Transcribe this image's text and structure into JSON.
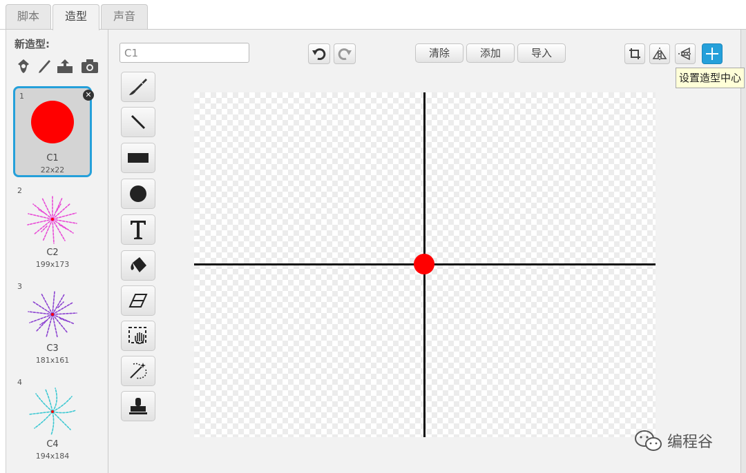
{
  "tabs": [
    {
      "label": "脚本",
      "active": false
    },
    {
      "label": "造型",
      "active": true
    },
    {
      "label": "声音",
      "active": false
    }
  ],
  "left_panel": {
    "new_costume_label": "新造型:",
    "new_costume_icons": [
      "character-icon",
      "paintbrush-icon",
      "upload-icon",
      "camera-icon"
    ]
  },
  "costumes": [
    {
      "number": "1",
      "name": "C1",
      "size": "22x22",
      "selected": true,
      "color": "#ff0000"
    },
    {
      "number": "2",
      "name": "C2",
      "size": "199x173",
      "selected": false,
      "color": "#e84bd6"
    },
    {
      "number": "3",
      "name": "C3",
      "size": "181x161",
      "selected": false,
      "color": "#8a3fd0"
    },
    {
      "number": "4",
      "name": "C4",
      "size": "194x184",
      "selected": false,
      "color": "#3cc8d2"
    }
  ],
  "editor": {
    "costume_name": "C1",
    "buttons": {
      "clear": "清除",
      "add": "添加",
      "import": "导入"
    },
    "top_icons": [
      "undo-icon",
      "redo-icon",
      "crop-icon",
      "flip-horizontal-icon",
      "flip-vertical-icon",
      "set-center-icon"
    ],
    "tools": [
      "brush-icon",
      "line-icon",
      "rectangle-icon",
      "ellipse-icon",
      "text-icon",
      "fill-icon",
      "eraser-icon",
      "select-icon",
      "magic-select-icon",
      "stamp-icon"
    ],
    "tooltip": "设置造型中心",
    "accent_color": "#25a0da",
    "costume_color": "#ff0000"
  },
  "watermark": "编程谷"
}
